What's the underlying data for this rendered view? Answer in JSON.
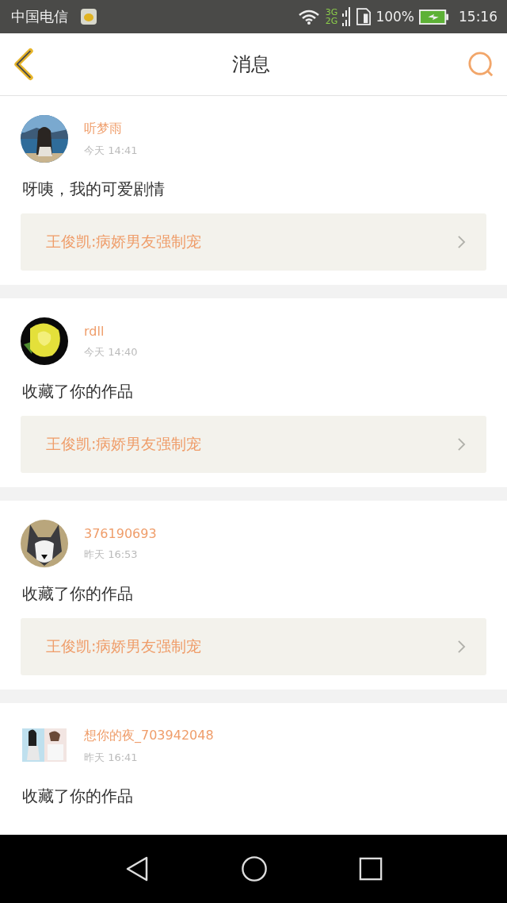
{
  "status_bar": {
    "carrier": "中国电信",
    "network_top": "3G",
    "network_bottom": "2G",
    "battery": "100%",
    "time": "15:16"
  },
  "header": {
    "title": "消息"
  },
  "messages": [
    {
      "name": "听梦雨",
      "time": "今天 14:41",
      "text": "呀咦，我的可爱剧情",
      "link": "王俊凯:病娇男友强制宠"
    },
    {
      "name": "rdll",
      "time": "今天 14:40",
      "text": "收藏了你的作品",
      "link": "王俊凯:病娇男友强制宠"
    },
    {
      "name": "376190693",
      "time": "昨天 16:53",
      "text": "收藏了你的作品",
      "link": "王俊凯:病娇男友强制宠"
    },
    {
      "name": "想你的夜_703942048",
      "time": "昨天 16:41",
      "text": "收藏了你的作品"
    }
  ]
}
